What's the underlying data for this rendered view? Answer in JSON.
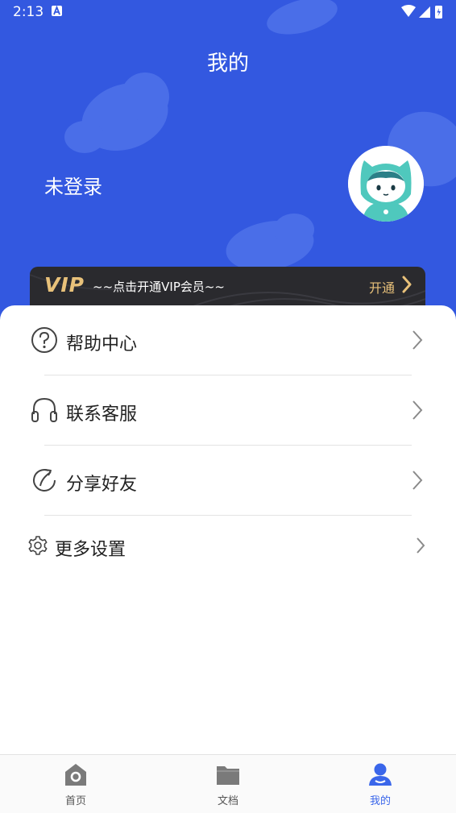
{
  "status_bar": {
    "time": "2:13",
    "app_icon": "a-letter-icon",
    "icons": [
      "wifi-icon",
      "signal-icon",
      "battery-icon"
    ]
  },
  "header": {
    "title": "我的",
    "login_status": "未登录",
    "avatar": "cat-hood-avatar"
  },
  "vip_banner": {
    "logo": "VIP",
    "text": "~~点击开通VIP会员~~",
    "action": "开通"
  },
  "menu": [
    {
      "label": "帮助中心",
      "icon": "help-icon"
    },
    {
      "label": "联系客服",
      "icon": "headset-icon"
    },
    {
      "label": "分享好友",
      "icon": "share-icon"
    },
    {
      "label": "更多设置",
      "icon": "gear-icon"
    }
  ],
  "bottom_nav": [
    {
      "label": "首页",
      "icon": "home-icon",
      "active": false
    },
    {
      "label": "文档",
      "icon": "folder-icon",
      "active": false
    },
    {
      "label": "我的",
      "icon": "person-icon",
      "active": true
    }
  ],
  "colors": {
    "header_blue": "#3358e0",
    "vip_gold": "#e8c17a",
    "vip_dark": "#2a2a2e",
    "nav_active": "#3a66ea",
    "nav_inactive": "#888888"
  }
}
